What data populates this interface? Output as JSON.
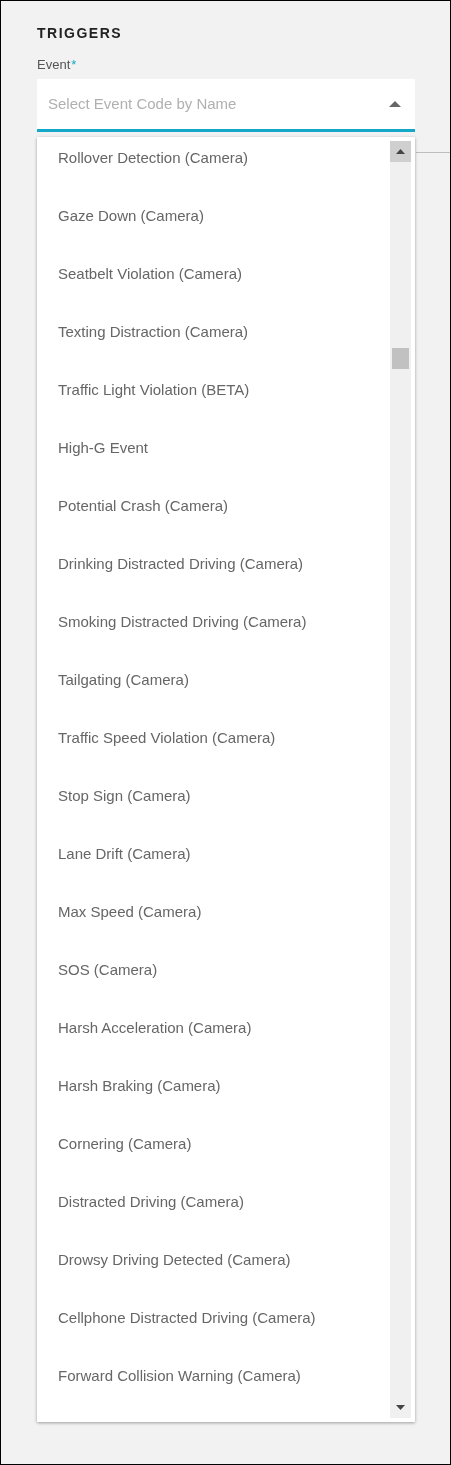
{
  "section_title": "TRIGGERS",
  "event_field": {
    "label": "Event",
    "required_mark": "*",
    "placeholder": "Select Event Code by Name",
    "expanded": true
  },
  "options": [
    {
      "label": "Rollover Detection (Camera)"
    },
    {
      "label": "Gaze Down (Camera)"
    },
    {
      "label": "Seatbelt Violation (Camera)"
    },
    {
      "label": "Texting Distraction (Camera)"
    },
    {
      "label": "Traffic Light Violation (BETA)"
    },
    {
      "label": "High-G Event"
    },
    {
      "label": "Potential Crash (Camera)"
    },
    {
      "label": "Drinking Distracted Driving (Camera)"
    },
    {
      "label": "Smoking Distracted Driving (Camera)"
    },
    {
      "label": "Tailgating (Camera)"
    },
    {
      "label": "Traffic Speed Violation (Camera)"
    },
    {
      "label": "Stop Sign (Camera)"
    },
    {
      "label": "Lane Drift (Camera)"
    },
    {
      "label": "Max Speed (Camera)"
    },
    {
      "label": "SOS (Camera)"
    },
    {
      "label": "Harsh Acceleration (Camera)"
    },
    {
      "label": "Harsh Braking (Camera)"
    },
    {
      "label": "Cornering (Camera)"
    },
    {
      "label": "Distracted Driving (Camera)"
    },
    {
      "label": "Drowsy Driving Detected (Camera)"
    },
    {
      "label": "Cellphone Distracted Driving (Camera)"
    },
    {
      "label": "Forward Collision Warning (Camera)"
    }
  ]
}
